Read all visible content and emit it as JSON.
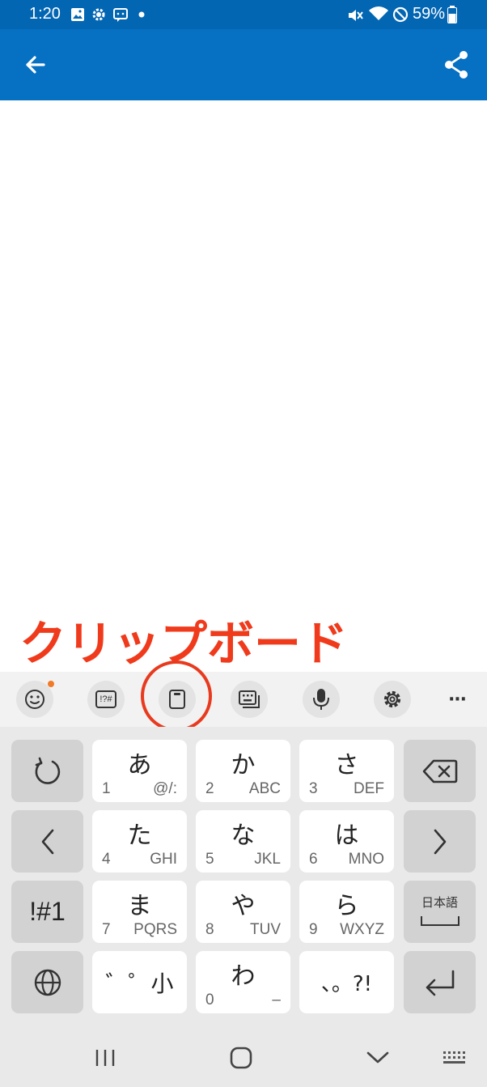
{
  "status_bar": {
    "time": "1:20",
    "battery": "59%",
    "icons": [
      "image-icon",
      "gear-icon",
      "message-icon",
      "dot-icon",
      "mute-icon",
      "wifi-icon",
      "blocked-icon",
      "battery-icon"
    ]
  },
  "app_bar": {
    "back_icon": "arrow-left-icon",
    "share_icon": "share-icon",
    "color": "#0670c2"
  },
  "annotation": {
    "label": "クリップボード",
    "color": "#e83a1e"
  },
  "toolbar": {
    "items": [
      "emoji-icon",
      "symbols-icon",
      "clipboard-icon",
      "keyboard-mode-icon",
      "mic-icon",
      "settings-icon",
      "more-icon"
    ],
    "symbols_label": "!?#",
    "more_label": "···",
    "notification_color": "#f07a27"
  },
  "keyboard": {
    "row1": [
      {
        "kana": "あ",
        "num": "1",
        "latin": "@/:"
      },
      {
        "kana": "か",
        "num": "2",
        "latin": "ABC"
      },
      {
        "kana": "さ",
        "num": "3",
        "latin": "DEF"
      }
    ],
    "row2": [
      {
        "kana": "た",
        "num": "4",
        "latin": "GHI"
      },
      {
        "kana": "な",
        "num": "5",
        "latin": "JKL"
      },
      {
        "kana": "は",
        "num": "6",
        "latin": "MNO"
      }
    ],
    "row3": [
      {
        "kana": "ま",
        "num": "7",
        "latin": "PQRS"
      },
      {
        "kana": "や",
        "num": "8",
        "latin": "TUV"
      },
      {
        "kana": "ら",
        "num": "9",
        "latin": "WXYZ"
      }
    ],
    "row4": [
      {
        "kana": "゛゜小"
      },
      {
        "kana": "わ",
        "num": "0",
        "latin": "–"
      },
      {
        "kana": "、。?!"
      }
    ],
    "symbols_key": "!#1",
    "language_key": "日本語"
  },
  "nav_bar": {
    "items": [
      "recents-icon",
      "home-icon",
      "back-chevron-icon",
      "keyboard-grid-icon"
    ]
  }
}
